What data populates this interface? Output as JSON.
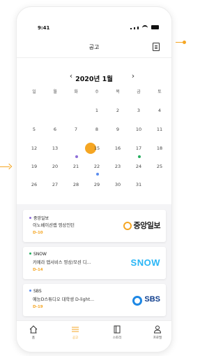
{
  "status_bar": {
    "time": "9:41"
  },
  "header": {
    "title": "공고"
  },
  "calendar": {
    "month_label": "2020년 1월",
    "prev_label": "‹",
    "next_label": "›",
    "weekdays": [
      "일",
      "월",
      "화",
      "수",
      "목",
      "금",
      "토"
    ],
    "weeks": [
      [
        "",
        "",
        "",
        "1",
        "2",
        "3",
        "4"
      ],
      [
        "5",
        "6",
        "7",
        "8",
        "9",
        "10",
        "11"
      ],
      [
        "12",
        "13",
        "14",
        "15",
        "16",
        "17",
        "18"
      ],
      [
        "19",
        "20",
        "21",
        "22",
        "23",
        "24",
        "25"
      ],
      [
        "26",
        "27",
        "28",
        "29",
        "30",
        "31",
        ""
      ]
    ],
    "today": "14",
    "colors": {
      "today": "#f5a623",
      "purple": "#8e6fd8",
      "green": "#27ae60",
      "blue": "#5b8def"
    }
  },
  "cards": [
    {
      "source": "중앙일보",
      "title": "이노베이션랩 영상인턴",
      "dday": "D-10",
      "logo": "중앙일보",
      "bullet_color": "#8e6fd8"
    },
    {
      "source": "SNOW",
      "title": "카메라 앱서비스 영상/모션 디...",
      "dday": "D-14",
      "logo": "SNOW",
      "bullet_color": "#27ae60"
    },
    {
      "source": "SBS",
      "title": "예능D스튜디오 대학생 D-light...",
      "dday": "D-19",
      "logo": "SBS",
      "bullet_color": "#5b8def"
    }
  ],
  "tabs": [
    {
      "label": "홈",
      "icon": "home-icon"
    },
    {
      "label": "공고",
      "icon": "list-icon"
    },
    {
      "label": "스토리",
      "icon": "story-icon"
    },
    {
      "label": "프로필",
      "icon": "profile-icon"
    }
  ],
  "accent_color": "#f5a623"
}
